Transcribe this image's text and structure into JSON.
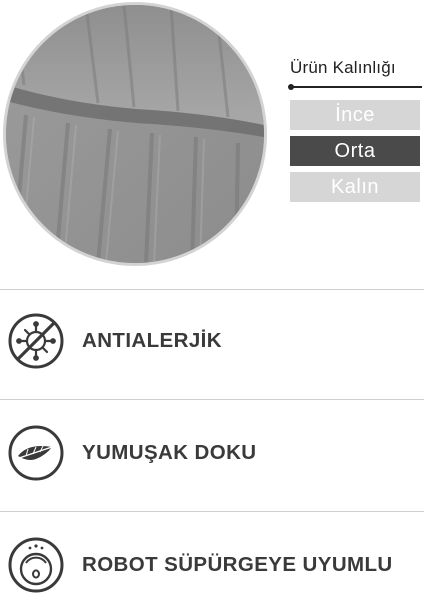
{
  "product_image": {
    "icon": "grey-towel-photo",
    "color": "#9a9a9a"
  },
  "thickness": {
    "title": "Ürün Kalınlığı",
    "options": [
      {
        "label": "İnce",
        "selected": false
      },
      {
        "label": "Orta",
        "selected": true
      },
      {
        "label": "Kalın",
        "selected": false
      }
    ],
    "colors": {
      "unselected": "#d6d6d6",
      "selected": "#4a4a4a"
    }
  },
  "features": [
    {
      "label": "ANTIALERJİK",
      "icon": "anti-allergen-icon"
    },
    {
      "label": "YUMUŞAK DOKU",
      "icon": "feather-icon"
    },
    {
      "label": "ROBOT SÜPÜRGEYE UYUMLU",
      "icon": "robot-vacuum-icon"
    }
  ]
}
